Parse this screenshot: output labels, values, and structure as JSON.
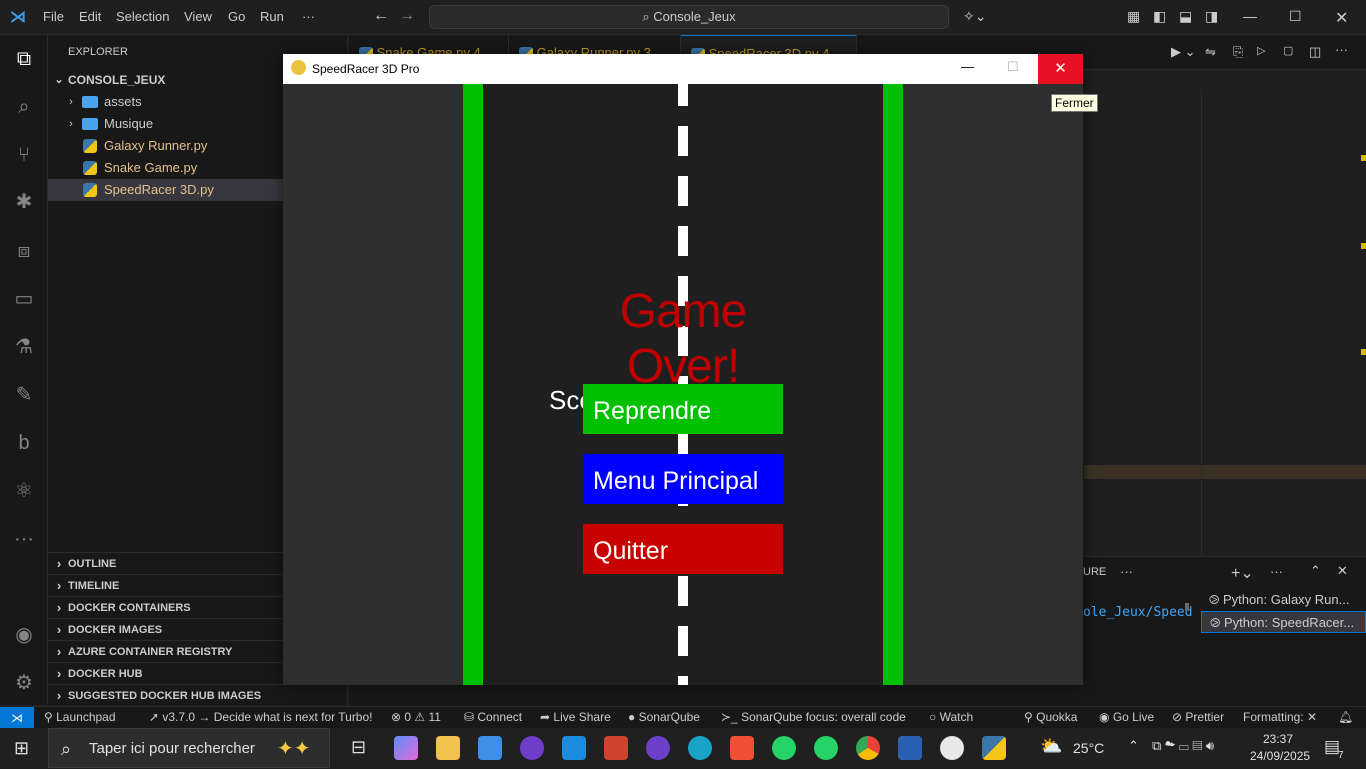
{
  "titlebar": {
    "menus": [
      "File",
      "Edit",
      "Selection",
      "View",
      "Go",
      "Run",
      "···"
    ],
    "search": "Console_Jeux"
  },
  "explorer": {
    "header": "EXPLORER",
    "root": "CONSOLE_JEUX",
    "items": [
      {
        "label": "assets",
        "kind": "folder"
      },
      {
        "label": "Musique",
        "kind": "folder"
      },
      {
        "label": "Galaxy Runner.py",
        "kind": "python"
      },
      {
        "label": "Snake Game.py",
        "kind": "python"
      },
      {
        "label": "SpeedRacer 3D.py",
        "kind": "python"
      }
    ],
    "sections": [
      "OUTLINE",
      "TIMELINE",
      "DOCKER CONTAINERS",
      "DOCKER IMAGES",
      "AZURE CONTAINER REGISTRY",
      "DOCKER HUB",
      "SUGGESTED DOCKER HUB IMAGES"
    ]
  },
  "editor": {
    "tabs": [
      "Snake Game.py 4",
      "Galaxy Runner.py 3",
      "SpeedRacer 3D.py 4"
    ]
  },
  "panel": {
    "partial_label": "URE",
    "path_fragment": "ole_Jeux/Speed",
    "terminals": [
      "Python: Galaxy Run...",
      "Python: SpeedRacer..."
    ]
  },
  "game": {
    "window_title": "SpeedRacer 3D Pro",
    "tooltip": "Fermer",
    "headline": "Game Over!",
    "score_fragment": "Sco",
    "buttons": [
      {
        "label": "Reprendre",
        "color": "#00c000"
      },
      {
        "label": "Menu Principal",
        "color": "#0000ff"
      },
      {
        "label": "Quitter",
        "color": "#c80000"
      }
    ],
    "colors": {
      "road": "#1f1f1f",
      "grass": "#333333",
      "border": "#00c000",
      "lane": "#ffffff",
      "headline": "#c00000"
    }
  },
  "statusbar": {
    "launchpad": "Launchpad",
    "turbo": "v3.7.0 → Decide what is next for Turbo!",
    "errors": "0",
    "warnings": "11",
    "connect": "Connect",
    "liveshare": "Live Share",
    "sonar": "SonarQube",
    "sonar_focus": "SonarQube focus: overall code",
    "watch": "Watch",
    "quokka": "Quokka",
    "golive": "Go Live",
    "prettier": "Prettier",
    "formatting": "Formatting:"
  },
  "taskbar": {
    "search_placeholder": "Taper ici pour rechercher",
    "weather": "25°C",
    "time": "23:37",
    "date": "24/09/2025",
    "notifications": "7"
  }
}
